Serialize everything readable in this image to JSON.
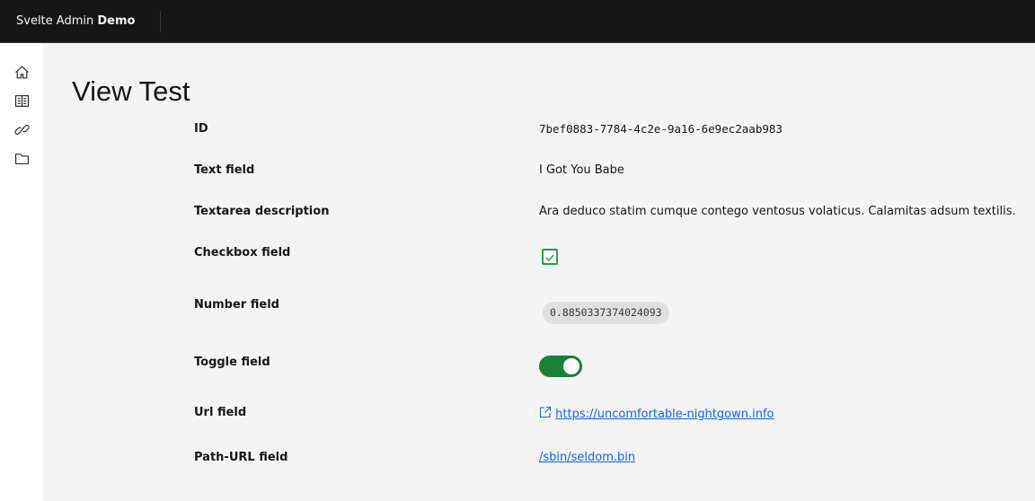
{
  "header": {
    "brand_prefix": "Svelte Admin",
    "brand_suffix": "Demo"
  },
  "sidebar": {
    "items": [
      {
        "icon": "home-icon"
      },
      {
        "icon": "list-icon"
      },
      {
        "icon": "link-icon"
      },
      {
        "icon": "folder-icon"
      }
    ]
  },
  "page": {
    "title": "View Test"
  },
  "fields": {
    "id": {
      "label": "ID",
      "value": "7bef0883-7784-4c2e-9a16-6e9ec2aab983"
    },
    "text": {
      "label": "Text field",
      "value": "I Got You Babe"
    },
    "textarea": {
      "label": "Textarea description",
      "value": "Ara deduco statim cumque contego ventosus volaticus. Calamitas adsum textilis."
    },
    "checkbox": {
      "label": "Checkbox field",
      "checked": true
    },
    "number": {
      "label": "Number field",
      "value": "0.8850337374024093"
    },
    "toggle": {
      "label": "Toggle field",
      "on": true
    },
    "url": {
      "label": "Url field",
      "value": "https://uncomfortable-nightgown.info"
    },
    "path": {
      "label": "Path-URL field",
      "value": "/sbin/seldom.bin"
    }
  },
  "colors": {
    "header": "#161616",
    "accent_green": "#198038",
    "link": "#0f62fe"
  }
}
